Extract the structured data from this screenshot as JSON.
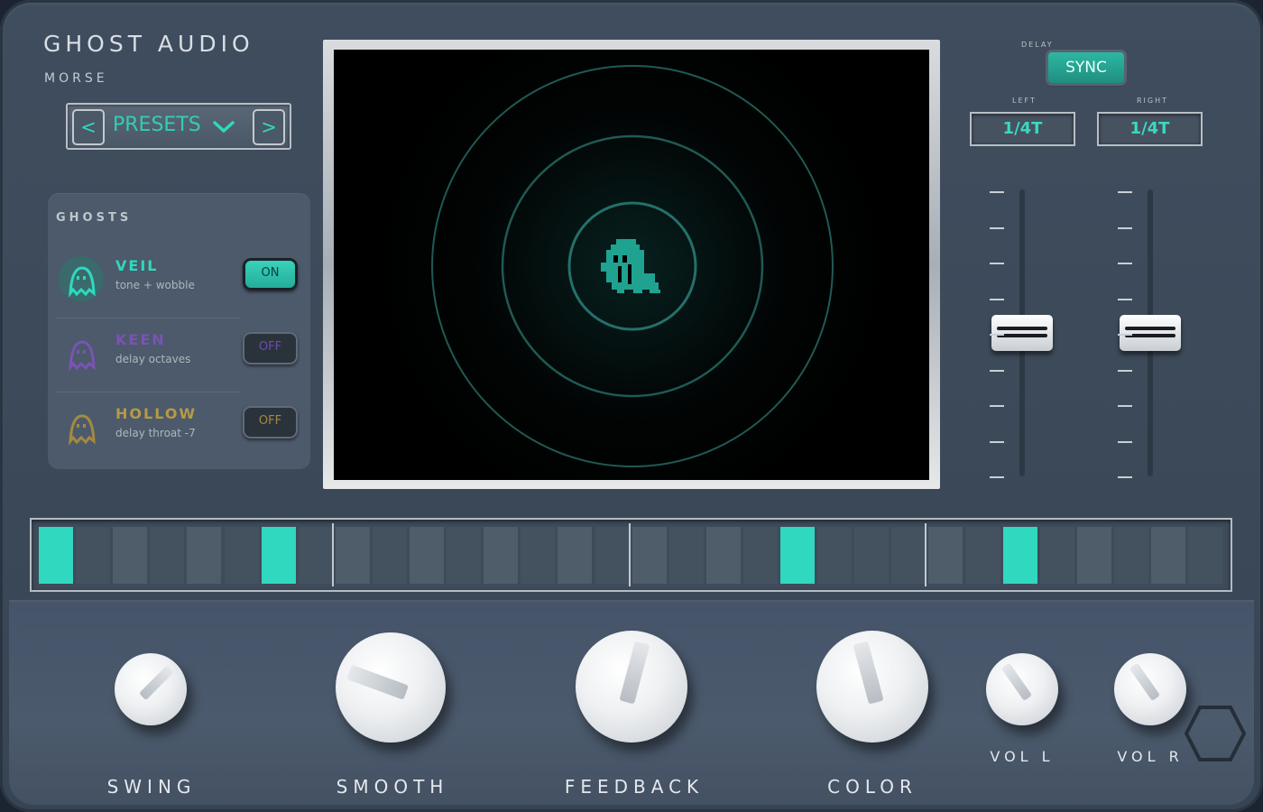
{
  "brand": {
    "title": "GHOST AUDIO",
    "subtitle": "MORSE"
  },
  "presets": {
    "label": "PRESETS",
    "prev": "<",
    "next": ">"
  },
  "ghosts": {
    "title": "GHOSTS",
    "items": [
      {
        "name": "VEIL",
        "desc": "tone + wobble",
        "state": "ON",
        "color": "#2fd8bf"
      },
      {
        "name": "KEEN",
        "desc": "delay octaves",
        "state": "OFF",
        "color": "#7a53b5"
      },
      {
        "name": "HOLLOW",
        "desc": "delay throat -7",
        "state": "OFF",
        "color": "#a38a40"
      }
    ]
  },
  "delay": {
    "label": "DELAY",
    "sync_label": "SYNC",
    "left_label": "LEFT",
    "right_label": "RIGHT",
    "left_value": "1/4T",
    "right_value": "1/4T"
  },
  "faders": {
    "left_level": 0.5,
    "right_level": 0.5
  },
  "sequencer": {
    "steps": [
      1,
      0,
      0,
      0,
      0,
      0,
      1,
      0,
      0,
      0,
      0,
      0,
      0,
      0,
      0,
      0,
      0,
      0,
      0,
      0,
      1,
      0,
      0,
      0,
      0,
      0,
      1,
      0,
      0,
      0,
      0,
      0
    ],
    "active_color": "#2fd8bf"
  },
  "knobs": {
    "swing": "SWING",
    "smooth": "SMOOTH",
    "feedback": "FEEDBACK",
    "color": "COLOR",
    "vol_l": "VOL L",
    "vol_r": "VOL R"
  },
  "colors": {
    "accent": "#2fd8bf",
    "panel": "#3e4c5c"
  }
}
